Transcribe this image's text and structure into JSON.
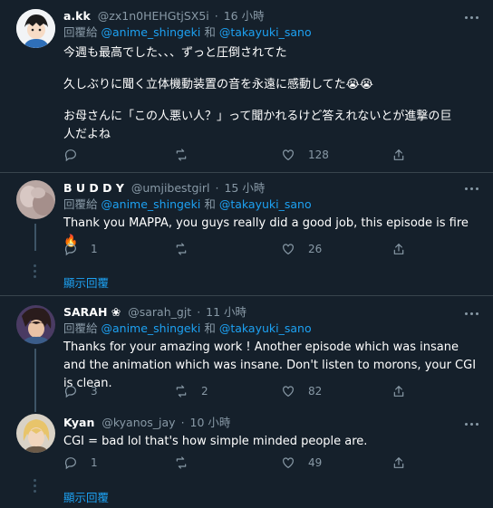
{
  "tweets": [
    {
      "name": "a.kk",
      "handle": "@zx1n0HEHGtjSX5i",
      "dot": "·",
      "time": "16 小時",
      "reply_prefix": "回覆給",
      "mention1": "@anime_shingeki",
      "and": "和",
      "mention2": "@takayuki_sano",
      "paragraphs": [
        "今週も最高でした、、、ずっと圧倒されてた",
        "久しぶりに聞く立体機動装置の音を永遠に感動してた😭😭",
        "お母さんに「この人悪い人？」って聞かれるけど答えれないとが進撃の巨\n人だよね"
      ],
      "replies": "",
      "retweets": "",
      "likes": "128"
    },
    {
      "name": "B U D D Y",
      "handle": "@umjibestgirl",
      "dot": "·",
      "time": "15 小時",
      "reply_prefix": "回覆給",
      "mention1": "@anime_shingeki",
      "and": "和",
      "mention2": "@takayuki_sano",
      "paragraphs": [
        "Thank you MAPPA, you guys really did a good job, this episode is fire🔥"
      ],
      "replies": "1",
      "retweets": "",
      "likes": "26"
    },
    {
      "name": "SARAH ❀",
      "handle": "@sarah_gjt",
      "dot": "·",
      "time": "11 小時",
      "reply_prefix": "回覆給",
      "mention1": "@anime_shingeki",
      "and": "和",
      "mention2": "@takayuki_sano",
      "paragraphs": [
        "Thanks for your amazing work ! Another episode which was insane and the animation which was insane. Don't listen to morons, your CGI is clean."
      ],
      "replies": "3",
      "retweets": "2",
      "likes": "82"
    },
    {
      "name": "Kyan",
      "handle": "@kyanos_jay",
      "dot": "·",
      "time": "10 小時",
      "paragraphs": [
        "CGI = bad lol that's how simple minded people are."
      ],
      "replies": "1",
      "retweets": "",
      "likes": "49"
    }
  ],
  "show_replies_1": "顯示回覆",
  "show_replies_2": "顯示回覆",
  "colors": {
    "background": "#15202b",
    "accent": "#1da1f2",
    "muted": "#8899a6",
    "divider": "#38444d"
  }
}
